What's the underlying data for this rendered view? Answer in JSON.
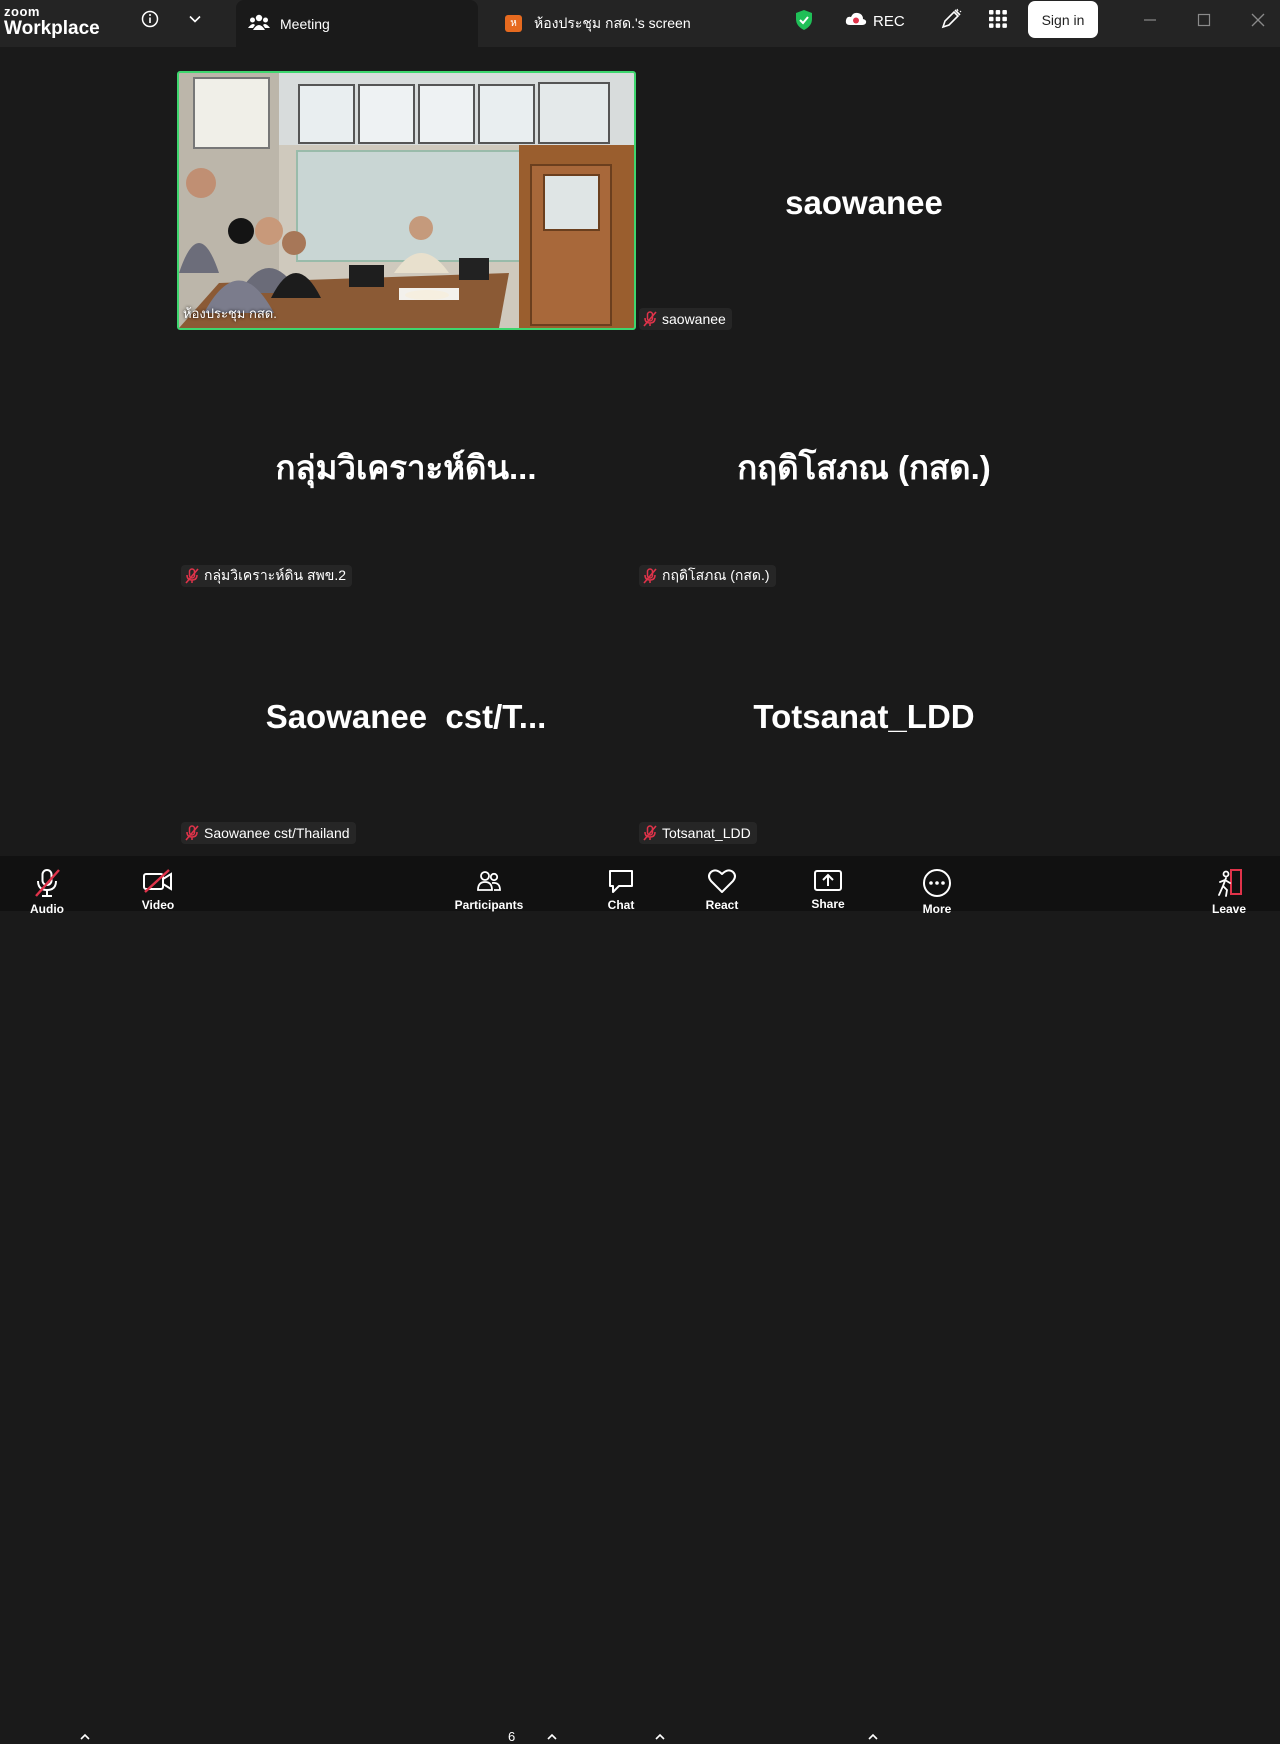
{
  "titlebar": {
    "brand_small": "zoom",
    "brand_large": "Workplace",
    "meeting_tab": "Meeting",
    "screen_badge": "ห",
    "screen_tab": "ห้องประชุม กสด.'s screen",
    "rec_label": "REC",
    "sign_in": "Sign in"
  },
  "tiles": {
    "video": {
      "name": "ห้องประชุม กสด."
    },
    "t2": {
      "display": "saowanee",
      "name": "saowanee"
    },
    "t3": {
      "display": "กลุ่มวิเคราะห์ดิน...",
      "name": "กลุ่มวิเคราะห์ดิน สพข.2"
    },
    "t4": {
      "display": "กฤดิโสภณ (กสด.)",
      "name": "กฤดิโสภณ (กสด.)"
    },
    "t5": {
      "display": "Saowanee  cst/T...",
      "name": "Saowanee cst/Thailand"
    },
    "t6": {
      "display": "Totsanat_LDD",
      "name": "Totsanat_LDD"
    }
  },
  "toolbar": {
    "audio": "Audio",
    "video": "Video",
    "participants": "Participants",
    "participant_count": "6",
    "chat": "Chat",
    "react": "React",
    "share": "Share",
    "more": "More",
    "leave": "Leave"
  },
  "colors": {
    "active_speaker": "#3ed66e",
    "muted_red": "#e0334a",
    "shield_green": "#1fbf57"
  }
}
